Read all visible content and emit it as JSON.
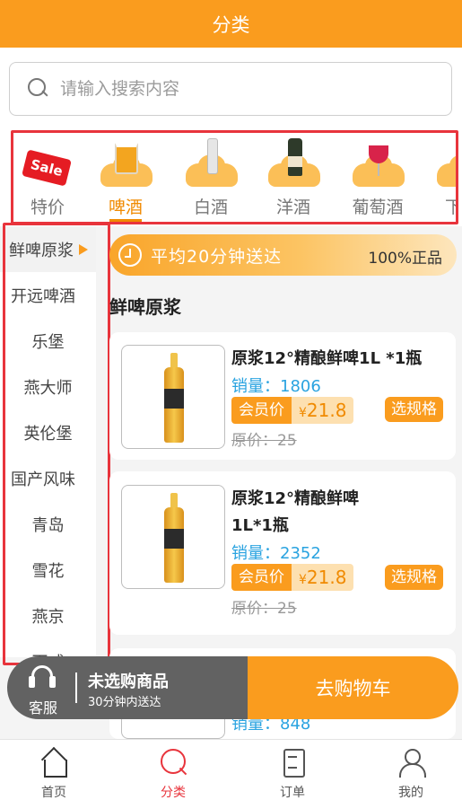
{
  "header": {
    "title": "分类"
  },
  "search": {
    "placeholder": "请输入搜索内容"
  },
  "categories": [
    {
      "label": "特价",
      "icon": "sale-icon"
    },
    {
      "label": "啤酒",
      "icon": "beer-mug-icon",
      "active": true
    },
    {
      "label": "白酒",
      "icon": "baijiu-bottle-icon"
    },
    {
      "label": "洋酒",
      "icon": "liquor-bottle-icon"
    },
    {
      "label": "葡萄酒",
      "icon": "wine-glass-icon"
    },
    {
      "label": "下酒",
      "icon": "snack-icon"
    }
  ],
  "sale_badge": "Sale",
  "sidebar": {
    "items": [
      {
        "label": "鲜啤原浆",
        "type": "group",
        "active": true
      },
      {
        "label": "开远啤酒",
        "type": "group"
      },
      {
        "label": "乐堡",
        "type": "sub"
      },
      {
        "label": "燕大师",
        "type": "sub"
      },
      {
        "label": "英伦堡",
        "type": "sub"
      },
      {
        "label": "国产风味",
        "type": "group"
      },
      {
        "label": "青岛",
        "type": "sub"
      },
      {
        "label": "雪花",
        "type": "sub"
      },
      {
        "label": "燕京",
        "type": "sub"
      },
      {
        "label": "百威",
        "type": "sub"
      }
    ]
  },
  "banner": {
    "delivery": "平均20分钟送达",
    "genuine": "100%正品"
  },
  "section_title": "鲜啤原浆",
  "products": [
    {
      "name": "原浆12°精酿鲜啤1L *1瓶",
      "sales_label": "销量：",
      "sales": "1806",
      "member_label": "会员价",
      "currency": "¥",
      "member_price": "21.8",
      "orig_label": "原价：",
      "orig_price": "25",
      "spec_button": "选规格"
    },
    {
      "name": "原浆12°精酿鲜啤1L*1瓶",
      "sales_label": "销量：",
      "sales": "2352",
      "member_label": "会员价",
      "currency": "¥",
      "member_price": "21.8",
      "orig_label": "原价：",
      "orig_price": "25",
      "spec_button": "选规格"
    },
    {
      "sales_label": "销量：",
      "sales": "848"
    }
  ],
  "cartbar": {
    "service_label": "客服",
    "title": "未选购商品",
    "subtitle": "30分钟内送达",
    "checkout": "去购物车"
  },
  "bottom_nav": [
    {
      "label": "首页",
      "icon": "home-icon"
    },
    {
      "label": "分类",
      "icon": "category-search-icon",
      "active": true
    },
    {
      "label": "订单",
      "icon": "order-icon"
    },
    {
      "label": "我的",
      "icon": "profile-icon"
    }
  ],
  "colors": {
    "brand": "#fa9c1e",
    "highlight_border": "#e8343c",
    "sales_blue": "#2aa3e0"
  }
}
